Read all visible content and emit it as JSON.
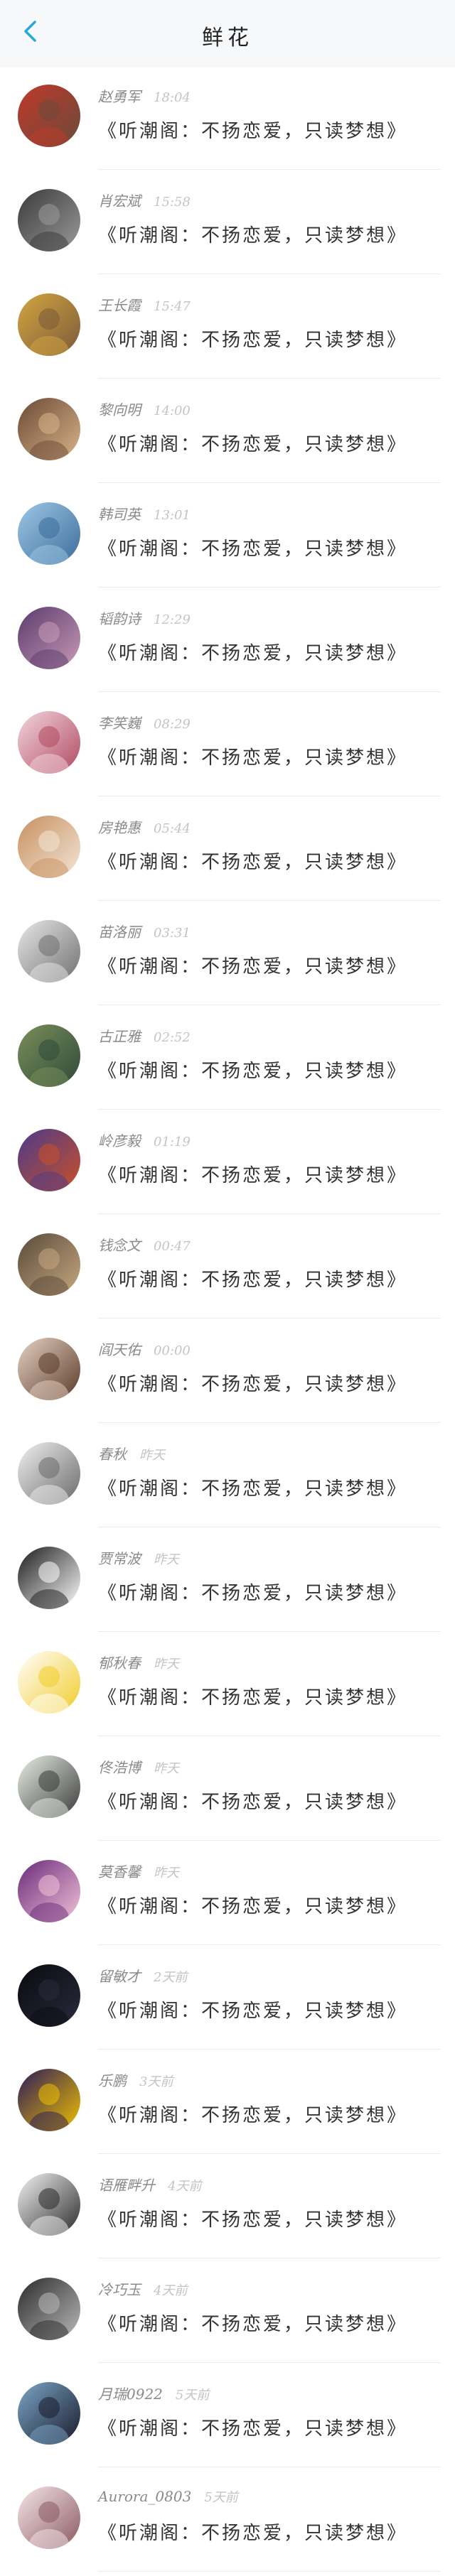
{
  "header": {
    "title": "鲜花",
    "back_icon": "chevron-left-icon",
    "accent_color": "#2aa7d8"
  },
  "items": [
    {
      "name": "赵勇军",
      "time": "18:04",
      "message": "《听潮阁：不扬恋爱，只读梦想》",
      "avatar_colors": [
        "#c0392b",
        "#6b4a3a"
      ]
    },
    {
      "name": "肖宏斌",
      "time": "15:58",
      "message": "《听潮阁：不扬恋爱，只读梦想》",
      "avatar_colors": [
        "#3a3a3a",
        "#9a9a9a"
      ]
    },
    {
      "name": "王长霞",
      "time": "15:47",
      "message": "《听潮阁：不扬恋爱，只读梦想》",
      "avatar_colors": [
        "#d4a640",
        "#7b5a3a"
      ]
    },
    {
      "name": "黎向明",
      "time": "14:00",
      "message": "《听潮阁：不扬恋爱，只读梦想》",
      "avatar_colors": [
        "#6b4a35",
        "#d9b48a"
      ]
    },
    {
      "name": "韩司英",
      "time": "13:01",
      "message": "《听潮阁：不扬恋爱，只读梦想》",
      "avatar_colors": [
        "#9fc7e6",
        "#3b6d9a"
      ]
    },
    {
      "name": "韬韵诗",
      "time": "12:29",
      "message": "《听潮阁：不扬恋爱，只读梦想》",
      "avatar_colors": [
        "#5a3a6a",
        "#c89ab8"
      ]
    },
    {
      "name": "李笑巍",
      "time": "08:29",
      "message": "《听潮阁：不扬恋爱，只读梦想》",
      "avatar_colors": [
        "#f3d6df",
        "#b04a60"
      ]
    },
    {
      "name": "房艳惠",
      "time": "05:44",
      "message": "《听潮阁：不扬恋爱，只读梦想》",
      "avatar_colors": [
        "#c89060",
        "#f2e6d6"
      ]
    },
    {
      "name": "苗洛丽",
      "time": "03:31",
      "message": "《听潮阁：不扬恋爱，只读梦想》",
      "avatar_colors": [
        "#e8e8e8",
        "#707070"
      ]
    },
    {
      "name": "古正雅",
      "time": "02:52",
      "message": "《听潮阁：不扬恋爱，只读梦想》",
      "avatar_colors": [
        "#7a8f5a",
        "#2f4a3a"
      ]
    },
    {
      "name": "岭彦毅",
      "time": "01:19",
      "message": "《听潮阁：不扬恋爱，只读梦想》",
      "avatar_colors": [
        "#4b3a8a",
        "#c8502a"
      ]
    },
    {
      "name": "钱念文",
      "time": "00:47",
      "message": "《听潮阁：不扬恋爱，只读梦想》",
      "avatar_colors": [
        "#5a4a3a",
        "#c6a880"
      ]
    },
    {
      "name": "阎天佑",
      "time": "00:00",
      "message": "《听潮阁：不扬恋爱，只读梦想》",
      "avatar_colors": [
        "#e6d2c2",
        "#5a3a2a"
      ]
    },
    {
      "name": "春秋",
      "time": "昨天",
      "message": "《听潮阁：不扬恋爱，只读梦想》",
      "avatar_colors": [
        "#f0f0f0",
        "#6a6a6a"
      ]
    },
    {
      "name": "贾常波",
      "time": "昨天",
      "message": "《听潮阁：不扬恋爱，只读梦想》",
      "avatar_colors": [
        "#1a1a1a",
        "#ffffff"
      ]
    },
    {
      "name": "郁秋春",
      "time": "昨天",
      "message": "《听潮阁：不扬恋爱，只读梦想》",
      "avatar_colors": [
        "#ffffff",
        "#f2cc2a"
      ]
    },
    {
      "name": "佟浩博",
      "time": "昨天",
      "message": "《听潮阁：不扬恋爱，只读梦想》",
      "avatar_colors": [
        "#e8efe6",
        "#3a3a3a"
      ]
    },
    {
      "name": "莫香馨",
      "time": "昨天",
      "message": "《听潮阁：不扬恋爱，只读梦想》",
      "avatar_colors": [
        "#6a2a7a",
        "#f2c2d8"
      ]
    },
    {
      "name": "留敏才",
      "time": "2天前",
      "message": "《听潮阁：不扬恋爱，只读梦想》",
      "avatar_colors": [
        "#0a0a10",
        "#2a2a3a"
      ]
    },
    {
      "name": "乐鹏",
      "time": "3天前",
      "message": "《听潮阁：不扬恋爱，只读梦想》",
      "avatar_colors": [
        "#2a1a5a",
        "#f0c000"
      ]
    },
    {
      "name": "语雁畔升",
      "time": "4天前",
      "message": "《听潮阁：不扬恋爱，只读梦想》",
      "avatar_colors": [
        "#f4f4f4",
        "#2a2a2a"
      ]
    },
    {
      "name": "冷巧玉",
      "time": "4天前",
      "message": "《听潮阁：不扬恋爱，只读梦想》",
      "avatar_colors": [
        "#2a2a2a",
        "#bababa"
      ]
    },
    {
      "name": "月瑞0922",
      "time": "5天前",
      "message": "《听潮阁：不扬恋爱，只读梦想》",
      "avatar_colors": [
        "#7aa6c8",
        "#1a1a2a"
      ]
    },
    {
      "name": "Aurora_0803",
      "time": "5天前",
      "message": "《听潮阁：不扬恋爱，只读梦想》",
      "avatar_colors": [
        "#f6e6ea",
        "#8a5a60"
      ]
    }
  ]
}
